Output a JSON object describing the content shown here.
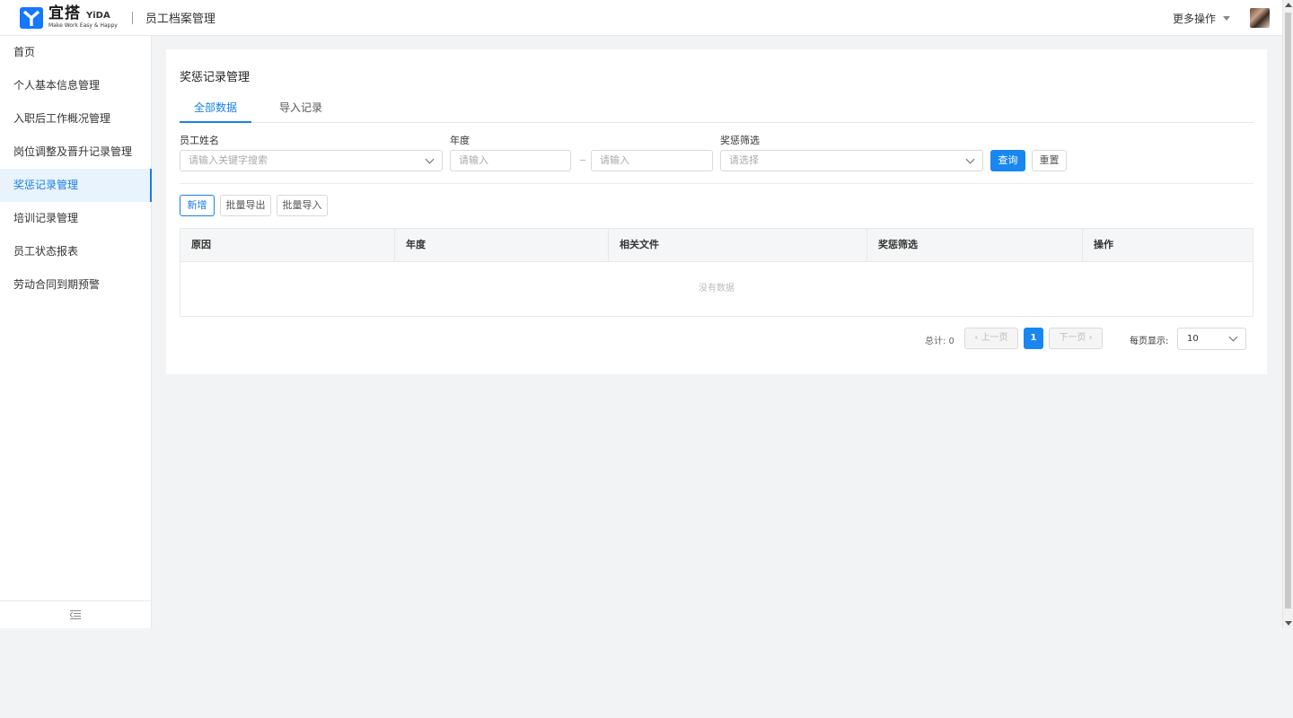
{
  "header": {
    "logo_cn": "宜搭",
    "logo_en": "YiDA",
    "logo_slogan": "Make Work Easy & Happy",
    "app_title": "员工档案管理",
    "more_ops": "更多操作"
  },
  "sidebar": {
    "items": [
      {
        "label": "首页"
      },
      {
        "label": "个人基本信息管理"
      },
      {
        "label": "入职后工作概况管理"
      },
      {
        "label": "岗位调整及晋升记录管理"
      },
      {
        "label": "奖惩记录管理"
      },
      {
        "label": "培训记录管理"
      },
      {
        "label": "员工状态报表"
      },
      {
        "label": "劳动合同到期预警"
      }
    ],
    "active_index": 4
  },
  "page": {
    "title": "奖惩记录管理",
    "tabs": [
      {
        "label": "全部数据"
      },
      {
        "label": "导入记录"
      }
    ],
    "filters": {
      "name_label": "员工姓名",
      "name_placeholder": "请输入关键字搜索",
      "year_label": "年度",
      "year_from_placeholder": "请输入",
      "year_to_placeholder": "请输入",
      "reward_label": "奖惩筛选",
      "reward_placeholder": "请选择",
      "query_btn": "查询",
      "reset_btn": "重置"
    },
    "actions": {
      "add": "新增",
      "export": "批量导出",
      "import": "批量导入"
    },
    "table": {
      "columns": [
        "原因",
        "年度",
        "相关文件",
        "奖惩筛选",
        "操作"
      ],
      "empty_text": "没有数据"
    },
    "pagination": {
      "total": "总计: 0",
      "prev": "上一页",
      "current": "1",
      "next": "下一页",
      "per_page_label": "每页显示:",
      "per_page_value": "10"
    }
  },
  "colors": {
    "accent": "#1a87f0",
    "active_bg": "#e8f3fd"
  }
}
